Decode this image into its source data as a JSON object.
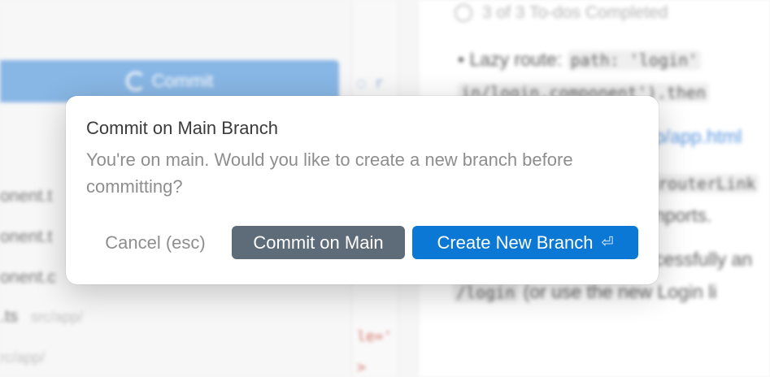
{
  "background": {
    "commit_button_label": "Commit",
    "files": [
      {
        "name": "onent.t",
        "path": ""
      },
      {
        "name": "onent.t",
        "path": ""
      },
      {
        "name": "onent.c",
        "path": ""
      },
      {
        "name": ".ts",
        "path": "src/app/"
      },
      {
        "name": "",
        "path": "rc/app/"
      }
    ],
    "gutter_marks": [
      "r",
      "le='",
      ">"
    ],
    "todo_status": "3 of 3 To-dos Completed",
    "notes": {
      "bullet_prefix": "Lazy route: ",
      "code1": "path: 'login'",
      "line2_code": "in/login.component').then",
      "link1": "p/app.html",
      "code2": "routerLink",
      "text3": "nports.",
      "text4": "cessfully an",
      "code3": "/login",
      "text5": "(or use the new Login li"
    }
  },
  "dialog": {
    "title": "Commit on Main Branch",
    "message": "You're on main. Would you like to create a new branch before committing?",
    "cancel_label": "Cancel (esc)",
    "commit_label": "Commit on Main",
    "create_label": "Create New Branch",
    "create_shortcut_icon": "return-key-icon"
  },
  "colors": {
    "primary_button": "#0a78d4",
    "secondary_button": "#5e6b78",
    "background_commit_button": "#5b9bdc"
  }
}
